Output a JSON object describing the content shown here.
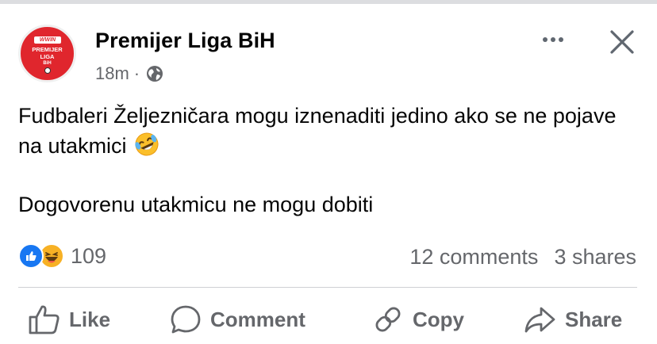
{
  "post": {
    "page_name": "Premijer Liga BiH",
    "time": "18m",
    "separator": "·",
    "visibility_icon": "globe-icon",
    "body_line1": "Fudbaleri Željezničara mogu iznenaditi jedino ako se ne pojave na utakmici",
    "body_emoji": "rolling-on-floor-laughing",
    "body_line2": "Dogovorenu utakmicu ne mogu dobiti"
  },
  "avatar": {
    "brand": "WWIN",
    "line1": "PREMIJER",
    "line2": "LIGA",
    "line3": "BiH"
  },
  "header_actions": {
    "more_icon": "more-dots-icon",
    "close_icon": "close-icon"
  },
  "reactions": {
    "types": [
      "like",
      "haha"
    ],
    "count": "109"
  },
  "stats": {
    "comments": "12 comments",
    "shares": "3 shares"
  },
  "actions": {
    "like": "Like",
    "comment": "Comment",
    "copy": "Copy",
    "share": "Share"
  },
  "colors": {
    "accent": "#1877f2",
    "secondary_text": "#65676b",
    "avatar_red": "#e0262d",
    "haha_yellow": "#f7b125"
  }
}
